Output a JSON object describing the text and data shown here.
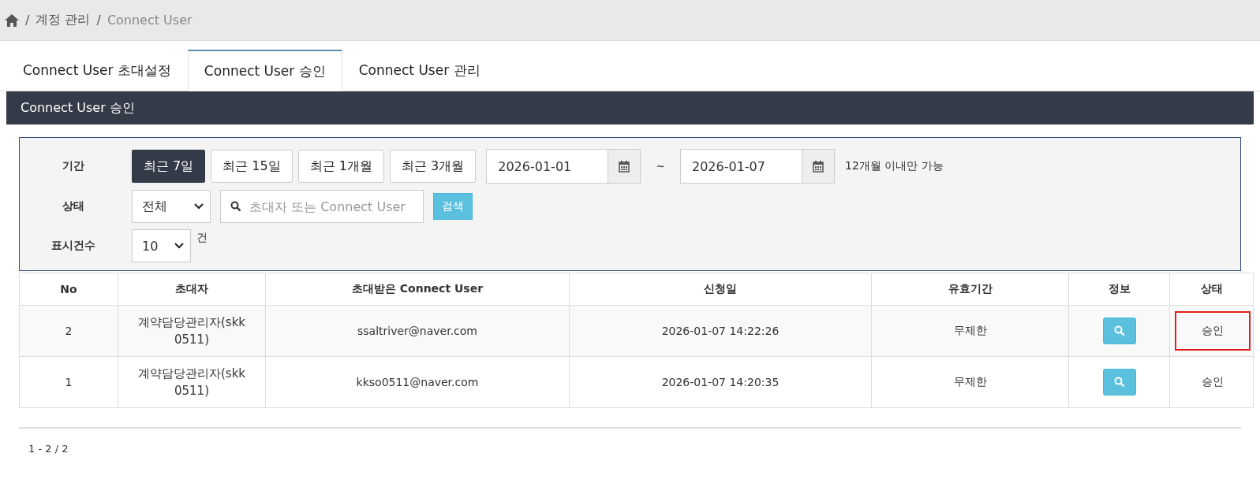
{
  "breadcrumb": [
    {
      "separator": "/",
      "label": "계정 관리"
    },
    {
      "separator": "/",
      "label": "Connect User"
    }
  ],
  "tabs": [
    {
      "label": "Connect User 초대설정",
      "selected": false
    },
    {
      "label": "Connect User 승인",
      "selected": true
    },
    {
      "label": "Connect User 관리",
      "selected": false
    }
  ],
  "panel_title": "Connect User 승인",
  "filters": {
    "period_label": "기간",
    "period_buttons": [
      {
        "label": "최근 7일",
        "selected": true
      },
      {
        "label": "최근 15일",
        "selected": false
      },
      {
        "label": "최근 1개월",
        "selected": false
      },
      {
        "label": "최근 3개월",
        "selected": false
      }
    ],
    "date_from": "2026-01-01",
    "date_sep": "~",
    "date_to": "2026-01-07",
    "date_note": "12개월 이내만 가능",
    "status_label": "상태",
    "status_value": "전체",
    "search_placeholder": "초대자 또는 Connect User",
    "search_button": "검색",
    "count_label": "표시건수",
    "count_value": "10",
    "count_unit": "건"
  },
  "table": {
    "columns": [
      "No",
      "초대자",
      "초대받은 Connect User",
      "신청일",
      "유효기간",
      "정보",
      "상태"
    ],
    "rows": [
      {
        "no": "2",
        "inviter": "계약담당관리자(skk0511)",
        "user": "ssaltriver@naver.com",
        "date": "2026-01-07 14:22:26",
        "validity": "무제한",
        "status": "승인",
        "highlighted": true
      },
      {
        "no": "1",
        "inviter": "계약담당관리자(skk0511)",
        "user": "kkso0511@naver.com",
        "date": "2026-01-07 14:20:35",
        "validity": "무제한",
        "status": "승인",
        "highlighted": false
      }
    ]
  },
  "pagination": "1 - 2 / 2"
}
